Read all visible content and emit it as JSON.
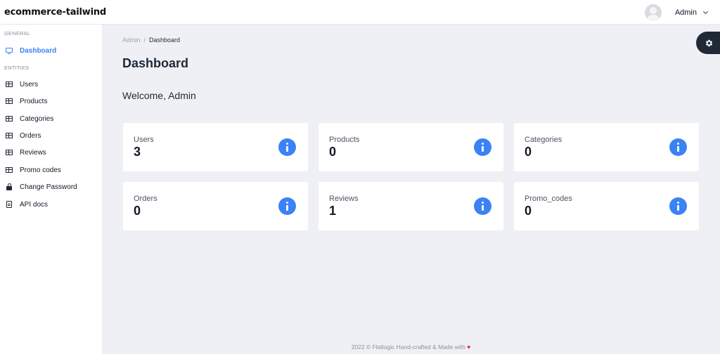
{
  "app": {
    "brand": "ecommerce-tailwind"
  },
  "header": {
    "user_name": "Admin"
  },
  "sidebar": {
    "general_label": "GENERAL",
    "entities_label": "ENTITIES",
    "items": [
      {
        "label": "Dashboard",
        "icon": "monitor-icon",
        "active": true
      },
      {
        "label": "Users",
        "icon": "table-icon"
      },
      {
        "label": "Products",
        "icon": "table-icon"
      },
      {
        "label": "Categories",
        "icon": "table-icon"
      },
      {
        "label": "Orders",
        "icon": "table-icon"
      },
      {
        "label": "Reviews",
        "icon": "table-icon"
      },
      {
        "label": "Promo codes",
        "icon": "table-icon"
      },
      {
        "label": "Change Password",
        "icon": "lock-icon"
      },
      {
        "label": "API docs",
        "icon": "document-icon"
      }
    ]
  },
  "breadcrumb": {
    "root": "Admin",
    "separator": "/",
    "current": "Dashboard"
  },
  "page": {
    "title": "Dashboard",
    "welcome": "Welcome, Admin"
  },
  "stats": [
    {
      "label": "Users",
      "value": "3"
    },
    {
      "label": "Products",
      "value": "0"
    },
    {
      "label": "Categories",
      "value": "0"
    },
    {
      "label": "Orders",
      "value": "0"
    },
    {
      "label": "Reviews",
      "value": "1"
    },
    {
      "label": "Promo_codes",
      "value": "0"
    }
  ],
  "footer": {
    "text": "2022 © Flatlogic Hand-crafted & Made with",
    "heart": "♥"
  },
  "colors": {
    "accent": "#3b82f6",
    "sidebar_bg": "#ffffff",
    "content_bg": "#eef0f5",
    "gear_tab_bg": "#1f2937"
  }
}
